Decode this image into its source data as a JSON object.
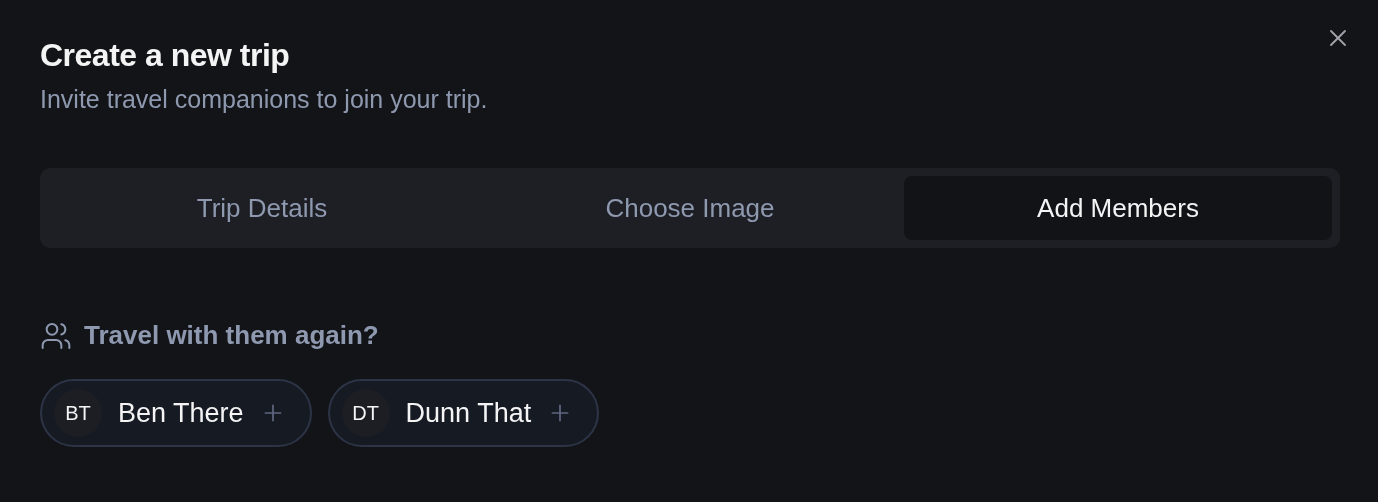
{
  "dialog": {
    "title": "Create a new trip",
    "description": "Invite travel companions to join your trip."
  },
  "tabs": [
    {
      "label": "Trip Details",
      "selected": false
    },
    {
      "label": "Choose Image",
      "selected": false
    },
    {
      "label": "Add Members",
      "selected": true
    }
  ],
  "suggestions": {
    "heading": "Travel with them again?",
    "people": [
      {
        "initials": "BT",
        "name": "Ben There"
      },
      {
        "initials": "DT",
        "name": "Dunn That"
      }
    ]
  }
}
